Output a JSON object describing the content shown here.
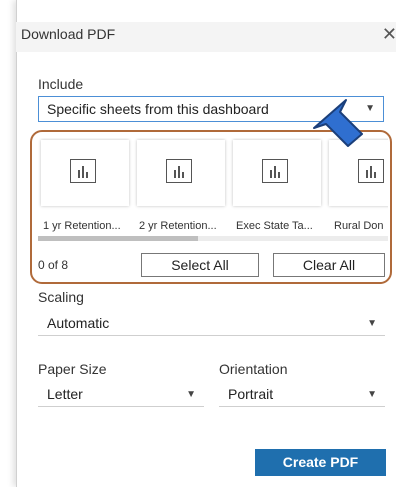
{
  "dialog": {
    "title": "Download PDF"
  },
  "include": {
    "label": "Include",
    "selected": "Specific sheets from this dashboard"
  },
  "sheets": {
    "items": [
      {
        "label": "1 yr Retention..."
      },
      {
        "label": "2 yr Retention..."
      },
      {
        "label": "Exec State Ta..."
      },
      {
        "label": "Rural Don"
      }
    ],
    "count_text": "0 of 8",
    "select_all_label": "Select All",
    "clear_all_label": "Clear All"
  },
  "scaling": {
    "label": "Scaling",
    "selected": "Automatic"
  },
  "paper_size": {
    "label": "Paper Size",
    "selected": "Letter"
  },
  "orientation": {
    "label": "Orientation",
    "selected": "Portrait"
  },
  "create_label": "Create PDF",
  "colors": {
    "highlight": "#b06a3a",
    "accent": "#1f6fae",
    "cursor_fill": "#2f6fd0"
  }
}
